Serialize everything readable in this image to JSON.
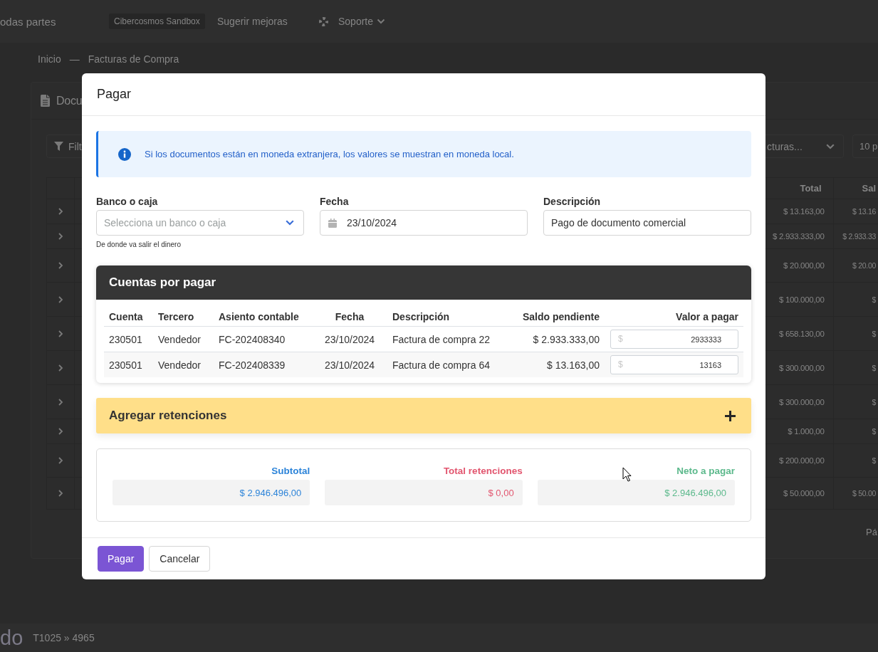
{
  "top_bar": {
    "scope": "odas partes",
    "environment_badge": "Cibercosmos Sandbox",
    "feedback_link": "Sugerir mejoras",
    "support_menu": "Soporte"
  },
  "breadcrumb": {
    "items": [
      "Inicio",
      "Facturas de Compra"
    ],
    "separator": "—"
  },
  "documents_panel": {
    "title": "Docu",
    "filter_button": "Filt",
    "type_select": "cturas...",
    "page_size_select": "10 p",
    "table": {
      "columns": [
        "Total",
        "Sal"
      ],
      "rows": [
        {
          "expanded": false,
          "cells": [
            "$ 13.163,00",
            "$ 13.16"
          ]
        },
        {
          "expanded": false,
          "cells": [
            "$ 2.933.333,00",
            "$ 2.933.33"
          ]
        },
        {
          "expanded": false,
          "cells": [
            "$ 20.000,00",
            "$ 20.00"
          ]
        },
        {
          "expanded": false,
          "cells": [
            "$ 100.000,00",
            "$"
          ]
        },
        {
          "expanded": false,
          "cells": [
            "$ 658.130,00",
            "$"
          ]
        },
        {
          "expanded": false,
          "cells": [
            "$ 300.000,00",
            "$"
          ]
        },
        {
          "expanded": false,
          "cells": [
            "$ 300.000,00",
            "$"
          ]
        },
        {
          "expanded": false,
          "cells": [
            "$ 1.000,00",
            "$"
          ]
        },
        {
          "expanded": false,
          "cells": [
            "$ 200.000,00",
            "$"
          ]
        },
        {
          "expanded": false,
          "cells": [
            "$ 50.000,00",
            "$ 50.00"
          ]
        }
      ]
    },
    "pagination": "Pá"
  },
  "modal": {
    "title": "Pagar",
    "notice": "Si los documentos están en moneda extranjera, los valores se muestran en moneda local.",
    "fields": [
      {
        "kind": "select",
        "label": "Banco o caja",
        "placeholder": "Selecciona un banco o caja",
        "help": "De donde va salir el dinero"
      },
      {
        "kind": "date",
        "label": "Fecha",
        "value": "23/10/2024"
      },
      {
        "kind": "text",
        "label": "Descripción",
        "value": "Pago de documento comercial"
      }
    ],
    "payables": {
      "title": "Cuentas por pagar",
      "columns": [
        "Cuenta",
        "Tercero",
        "Asiento contable",
        "Fecha",
        "Descripción",
        "Saldo pendiente",
        "Valor a pagar"
      ],
      "rows": [
        {
          "cells": [
            "230501",
            "Vendedor",
            "FC-202408340",
            "23/10/2024",
            "Factura de compra 22",
            "$ 2.933.333,00"
          ],
          "currency": "$",
          "amount": "2933333"
        },
        {
          "cells": [
            "230501",
            "Vendedor",
            "FC-202408339",
            "23/10/2024",
            "Factura de compra 64",
            "$ 13.163,00"
          ],
          "currency": "$",
          "amount": "13163"
        }
      ]
    },
    "withholdings": {
      "title": "Agregar retenciones",
      "expanded": false
    },
    "totals": [
      {
        "label": "Subtotal",
        "value": "$ 2.946.496,00",
        "color": "#2d84d9"
      },
      {
        "label": "Total retenciones",
        "value": "$ 0,00",
        "color": "#e2566f"
      },
      {
        "label": "Neto a pagar",
        "value": "$ 2.946.496,00",
        "color": "#5cb98c"
      }
    ],
    "buttons": [
      {
        "kind": "primary",
        "label": "Pagar"
      },
      {
        "kind": "secondary",
        "label": "Cancelar"
      }
    ]
  },
  "status_bar": {
    "title": "do",
    "path": "T1025 » 4965"
  }
}
